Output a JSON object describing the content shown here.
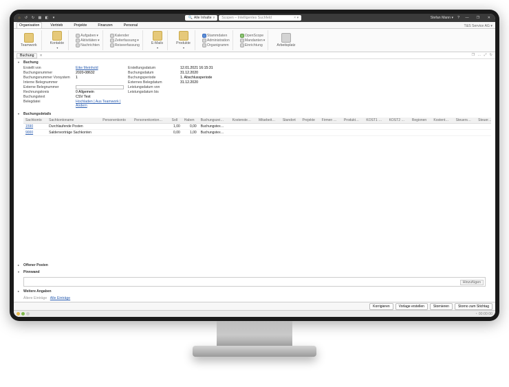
{
  "titlebar": {
    "search_scope": "Alle Inhalte",
    "search_placeholder": "Scopen – Intelligentes Suchfeld",
    "user": "Stefan Mann",
    "window_buttons": [
      "—",
      "❐",
      "✕"
    ]
  },
  "tabs": {
    "items": [
      "Organisation",
      "Vertrieb",
      "Projekte",
      "Finanzen",
      "Personal"
    ],
    "active": 0,
    "company": "T&S Service AG"
  },
  "ribbon": {
    "teamwork": "Teamwork",
    "kontakte": "Kontakte",
    "aufgaben": "Aufgaben",
    "aktivitaten": "Aktivitäten",
    "nachrichten": "Nachrichten",
    "kalender": "Kalender",
    "zeiterfassung": "Zeiterfassung",
    "reiseerfassung": "Reiseerfassung",
    "emails": "E-Mails",
    "produkte": "Produkte",
    "stammdaten": "Stammdaten",
    "administration": "Administration",
    "organigramm": "Organigramm",
    "openscope": "OpenScope",
    "mandanten": "Mandanten",
    "einrichtung": "Einrichtung",
    "arbeitsplatz": "Arbeitsplatz"
  },
  "subtab": {
    "name": "Buchung"
  },
  "sections": {
    "buchung": "Buchung",
    "details": "Buchungsdetails",
    "offener": "Offener Posten",
    "pinnwand": "Pinnwand",
    "weitere": "Weitere Angaben"
  },
  "form_left": [
    {
      "label": "Erstellt von",
      "value": "Eike Meinhold",
      "link": true
    },
    {
      "label": "Buchungsnummer",
      "value": "2020-08632"
    },
    {
      "label": "Buchungsnummer Vorsystem",
      "value": "1"
    },
    {
      "label": "Interne Belegnummer",
      "value": ""
    },
    {
      "label": "Externe Belegnummer",
      "value": "",
      "input": true
    },
    {
      "label": "Rechnungskreis",
      "value": "0 Allgemein"
    },
    {
      "label": "Buchungstext",
      "value": "CSV Test"
    },
    {
      "label": "Belegdatei",
      "value": "Hochladen | Aus Teamwork | Ändern",
      "link": true
    }
  ],
  "form_right": [
    {
      "label": "Erstellungsdatum",
      "value": "12.01.2021 16:15:31"
    },
    {
      "label": "Buchungsdatum",
      "value": "31.12.2020"
    },
    {
      "label": "Buchungsperiode",
      "value": "1. Abschlussperiode"
    },
    {
      "label": "Externes Belegdatum",
      "value": "31.12.2020"
    },
    {
      "label": "Leistungsdatum von",
      "value": ""
    },
    {
      "label": "Leistungsdatum bis",
      "value": ""
    }
  ],
  "table": {
    "headers": [
      "Sachkonto",
      "Sachkontoname",
      "Personenkonto",
      "Personenkonton…",
      "Soll",
      "Haben",
      "Buchungszei…",
      "Kostenste…",
      "Mitarbeit…",
      "Standort",
      "Projekte",
      "Firmen …",
      "Produkt…",
      "KOST1 …",
      "KOST2 …",
      "Regionen",
      "Kostent…",
      "Steuers…",
      "Steuer…"
    ],
    "rows": [
      {
        "konto": "1590",
        "name": "Durchlaufende Posten",
        "soll": "1,00",
        "haben": "0,00",
        "zeile": "Buchungstex…"
      },
      {
        "konto": "9000",
        "name": "Saldenvorträge Sachkonten",
        "soll": "0,00",
        "haben": "1,00",
        "zeile": "Buchungstex…"
      }
    ]
  },
  "pinn": {
    "add": "Hinzufügen"
  },
  "footer_links": {
    "old": "Ältere Einträge",
    "all": "Alle Einträge"
  },
  "actions": [
    "Korrigieren",
    "Vorlage erstellen",
    "Stornieren",
    "Storno zum Stichtag"
  ],
  "status": {
    "time": "00:00:00"
  }
}
